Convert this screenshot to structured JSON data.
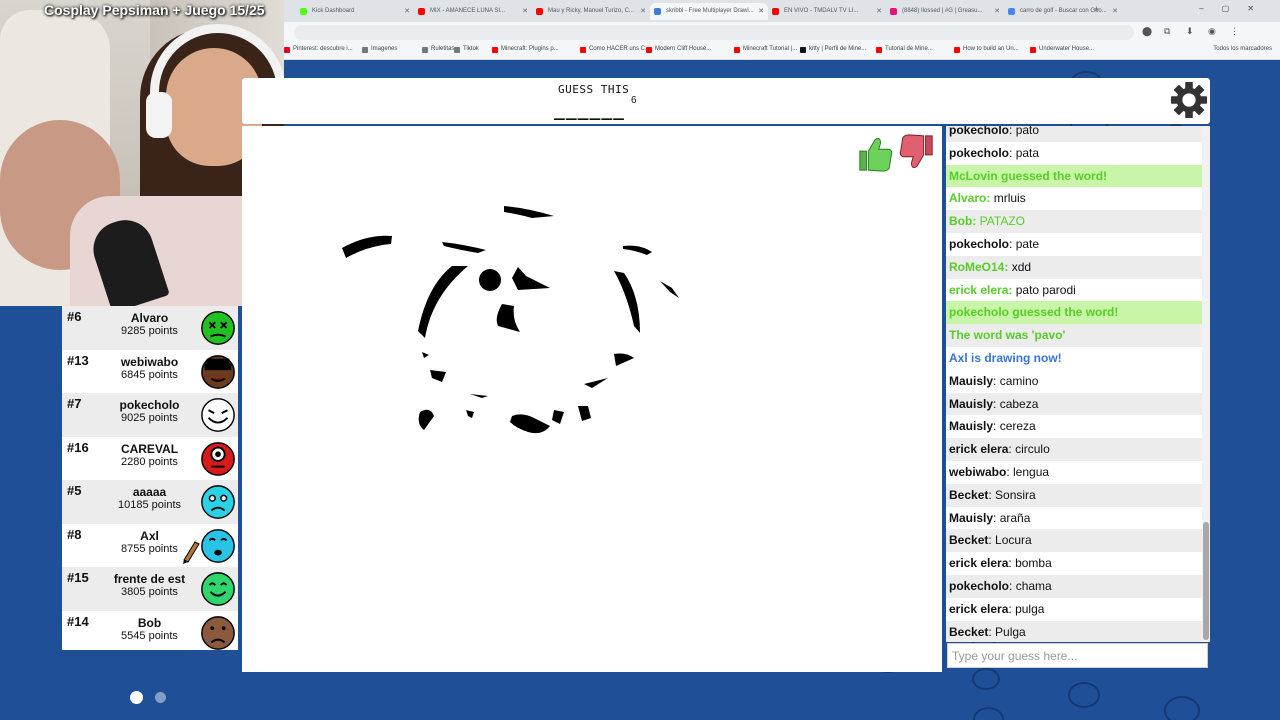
{
  "stream": {
    "title": "Cosplay Pepsiman + Juego 15/25"
  },
  "browser": {
    "tabs": [
      {
        "label": "Kick Dashboard",
        "color": "#53fc18"
      },
      {
        "label": "MIX - AMANECE LUNA SI...",
        "color": "#ff0000"
      },
      {
        "label": "Mau y Ricky, Manuel Turizo, C...",
        "color": "#ff0000"
      },
      {
        "label": "skribbl - Free Multiplayer Drawi...",
        "color": "#3c7dd9",
        "active": true
      },
      {
        "label": "EN VIVO - TMDALV TV LI...",
        "color": "#ff0000"
      },
      {
        "label": "(8848) Ilossed | #G | Greasu...",
        "color": "#e6127b"
      },
      {
        "label": "carro de golf - Buscar con Goo...",
        "color": "#4285f4"
      }
    ],
    "bookmarks": [
      {
        "label": "Pinterest: descubre i...",
        "color": "#e60023"
      },
      {
        "label": "Imagenes",
        "color": "#777777"
      },
      {
        "label": "Ruletitas",
        "color": "#777777"
      },
      {
        "label": "Tiktok",
        "color": "#777777"
      },
      {
        "label": "Minecraft: Plugins p...",
        "color": "#ff0000"
      },
      {
        "label": "Como HACER uns C...",
        "color": "#ff0000"
      },
      {
        "label": "Modern Cliff House...",
        "color": "#ff0000"
      },
      {
        "label": "Minecraft Tutorial |...",
        "color": "#ff0000"
      },
      {
        "label": "kitty | Perfil de Mine...",
        "color": "#111111"
      },
      {
        "label": "Tutorial de Mine...",
        "color": "#ff0000"
      },
      {
        "label": "How to build an Un...",
        "color": "#ff0000"
      },
      {
        "label": "Underwater House...",
        "color": "#ff0000"
      }
    ],
    "all_bookmarks": "Todos los marcadores"
  },
  "game": {
    "guess_label": "GUESS THIS",
    "word_length": "6",
    "word_hint": "______"
  },
  "players": [
    {
      "rank": "#6",
      "name": "Alvaro",
      "points": "9285 points",
      "color": "#22c122",
      "face": "x-eyes"
    },
    {
      "rank": "#13",
      "name": "webiwabo",
      "points": "6845 points",
      "color": "#6b3a1f",
      "face": "shades"
    },
    {
      "rank": "#7",
      "name": "pokecholo",
      "points": "9025 points",
      "color": "#ffffff",
      "face": "grin"
    },
    {
      "rank": "#16",
      "name": "CAREVAL",
      "points": "2280 points",
      "color": "#d71a1a",
      "face": "cyclops"
    },
    {
      "rank": "#5",
      "name": "aaaaa",
      "points": "10185 points",
      "color": "#29d2e6",
      "face": "sad"
    },
    {
      "rank": "#8",
      "name": "Axl",
      "points": "8755 points",
      "color": "#29c3e6",
      "face": "drawing",
      "drawing": true
    },
    {
      "rank": "#15",
      "name": "frente de est",
      "points": "3805 points",
      "color": "#2fd66b",
      "face": "happy"
    },
    {
      "rank": "#14",
      "name": "Bob",
      "points": "5545 points",
      "color": "#8b5a3c",
      "face": "frown"
    }
  ],
  "chat": {
    "messages": [
      {
        "author": "pokecholo",
        "text": "pato",
        "style": "normal"
      },
      {
        "author": "pokecholo",
        "text": "pata",
        "style": "normal"
      },
      {
        "author": "",
        "text": "McLovin guessed the word!",
        "style": "guessed"
      },
      {
        "author": "Alvaro",
        "text": "mrluis",
        "style": "green-author"
      },
      {
        "author": "Bob",
        "text": "PATAZO",
        "style": "green-all"
      },
      {
        "author": "pokecholo",
        "text": "pate",
        "style": "normal"
      },
      {
        "author": "RoMeO14",
        "text": "xdd",
        "style": "green-author"
      },
      {
        "author": "erick elera",
        "text": "pato parodi",
        "style": "green-author"
      },
      {
        "author": "",
        "text": "pokecholo guessed the word!",
        "style": "guessed"
      },
      {
        "author": "",
        "text": "The word was 'pavo'",
        "style": "word"
      },
      {
        "author": "",
        "text": "Axl is drawing now!",
        "style": "drawing"
      },
      {
        "author": "Mauisly",
        "text": "camino",
        "style": "normal"
      },
      {
        "author": "Mauisly",
        "text": "cabeza",
        "style": "normal"
      },
      {
        "author": "Mauisly",
        "text": "cereza",
        "style": "normal"
      },
      {
        "author": "erick elera",
        "text": "circulo",
        "style": "normal"
      },
      {
        "author": "webiwabo",
        "text": "lengua",
        "style": "normal"
      },
      {
        "author": "Becket",
        "text": "Sonsira",
        "style": "normal"
      },
      {
        "author": "Mauisly",
        "text": "araña",
        "style": "normal"
      },
      {
        "author": "Becket",
        "text": "Locura",
        "style": "normal"
      },
      {
        "author": "erick elera",
        "text": "bomba",
        "style": "normal"
      },
      {
        "author": "pokecholo",
        "text": "chama",
        "style": "normal"
      },
      {
        "author": "erick elera",
        "text": "pulga",
        "style": "normal"
      },
      {
        "author": "Becket",
        "text": "Pulga",
        "style": "normal"
      }
    ],
    "input_placeholder": "Type your guess here..."
  },
  "pagination": {
    "pages": 2,
    "active": 1
  },
  "colors": {
    "accent_green": "#56ce27",
    "accent_blue": "#3975ce",
    "background": "#1e4f97"
  }
}
